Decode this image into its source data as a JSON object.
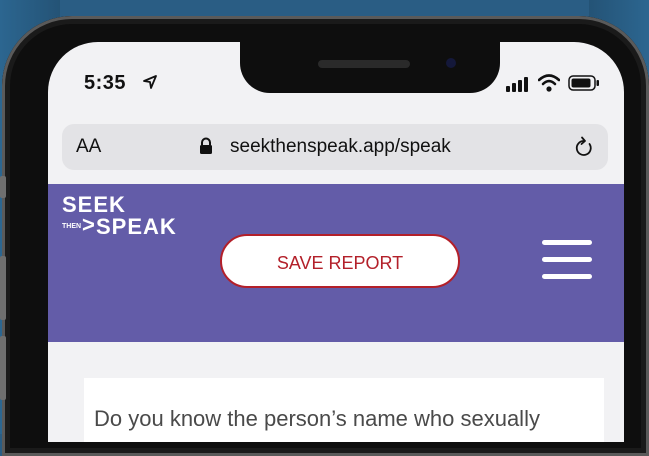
{
  "status_bar": {
    "time": "5:35",
    "icons": [
      "location-arrow-icon",
      "cellular-signal-icon",
      "wifi-icon",
      "battery-icon"
    ]
  },
  "browser": {
    "aa_label": "AA",
    "url": "seekthenspeak.app/speak",
    "icons": [
      "lock-icon",
      "reload-icon"
    ]
  },
  "header": {
    "logo": {
      "line1": "SEEK",
      "then": "THEN",
      "arrow": ">",
      "line2": "SPEAK"
    },
    "save_button_label": "SAVE REPORT",
    "menu_icon": "hamburger-menu-icon",
    "background_color": "#635ca8",
    "accent_color": "#b3202a"
  },
  "main": {
    "question": "Do you know the person’s name who sexually"
  }
}
